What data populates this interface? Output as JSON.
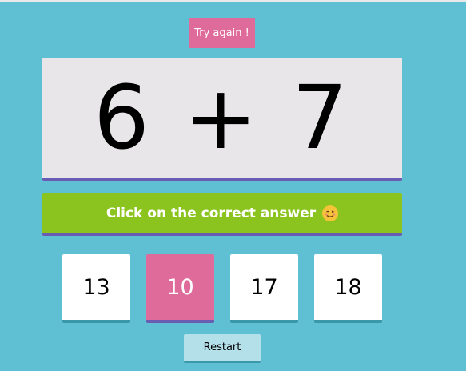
{
  "feedback": {
    "label": "Try again !",
    "color": "#df6b9a"
  },
  "equation": {
    "left": "6",
    "operator": "+",
    "right": "7",
    "display": "6 + 7"
  },
  "instruction": {
    "text": "Click on the correct answer",
    "emoji_icon": "winking-face-icon"
  },
  "answers": [
    {
      "value": "13",
      "selected": false
    },
    {
      "value": "10",
      "selected": true
    },
    {
      "value": "17",
      "selected": false
    },
    {
      "value": "18",
      "selected": false
    }
  ],
  "restart": {
    "label": "Restart"
  },
  "colors": {
    "background": "#5fbfd3",
    "equation_card": "#e8e6e8",
    "instruction_bar": "#8cc41f",
    "accent_border": "#6a5bb3",
    "selected_answer": "#df6b9a",
    "restart_button": "#b4e0ea"
  }
}
